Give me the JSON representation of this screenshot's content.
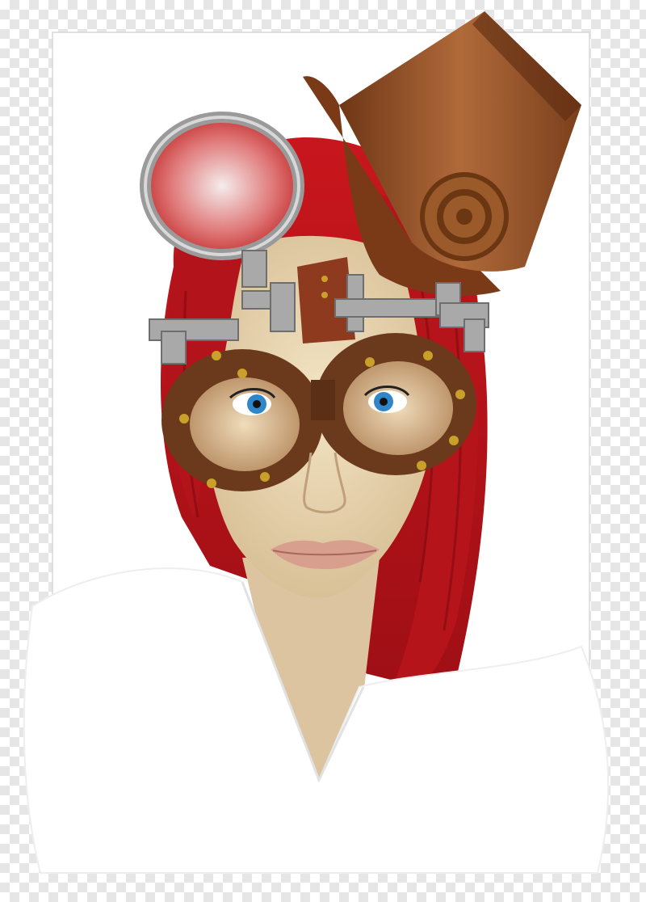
{
  "image": {
    "subject": "steampunk-portrait",
    "background": "transparency-checkerboard",
    "colors": {
      "checker_light": "#ffffff",
      "checker_dark": "#e6e6e6",
      "frame": "#ffffff",
      "frame_border": "#d8d8d8",
      "hair": "#c8161d",
      "hair_dark": "#8a0d12",
      "skin": "#ecd9b4",
      "skin_shadow": "#cfb58e",
      "hat": "#8a4a22",
      "hat_light": "#b06a3a",
      "goggles": "#6b3a1c",
      "rivet": "#c9a02a",
      "metal": "#a9a9a9",
      "iris": "#2f86c8",
      "lips": "#d99f8e",
      "shirt": "#ffffff"
    }
  }
}
